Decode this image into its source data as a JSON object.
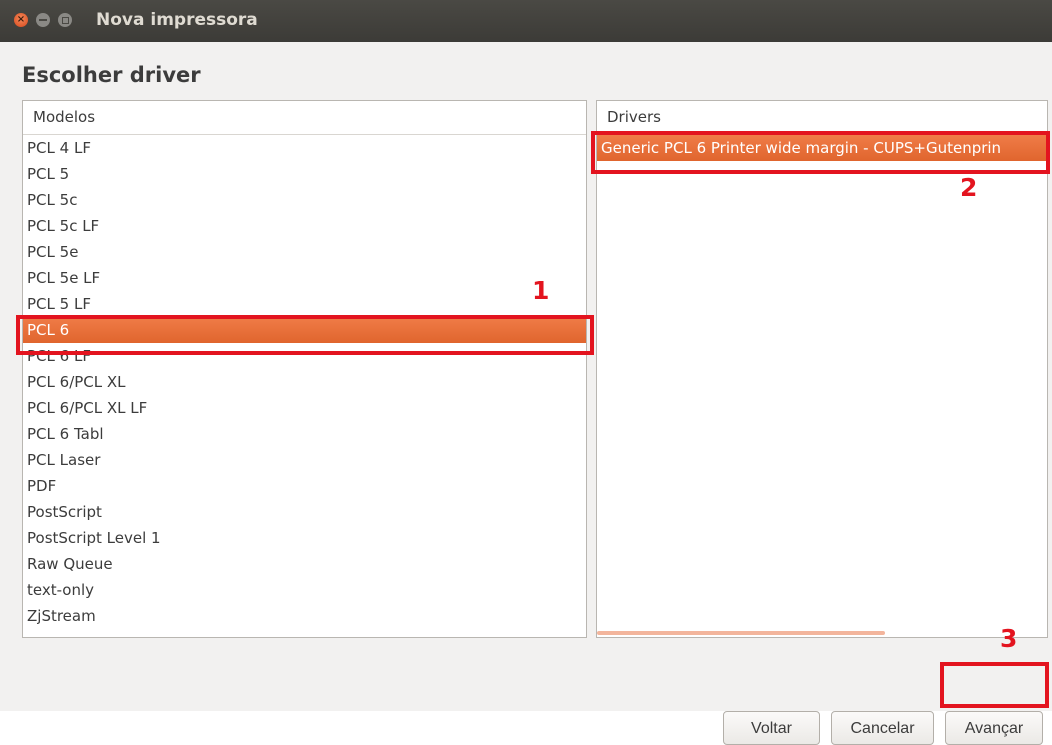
{
  "window": {
    "title": "Nova impressora",
    "close_glyph": "×"
  },
  "heading": "Escolher driver",
  "models": {
    "header": "Modelos",
    "items": [
      "PCL 4 LF",
      "PCL 5",
      "PCL 5c",
      "PCL 5c LF",
      "PCL 5e",
      "PCL 5e LF",
      "PCL 5 LF",
      "PCL 6",
      "PCL 6 LF",
      "PCL 6/PCL XL",
      "PCL 6/PCL XL LF",
      "PCL 6 Tabl",
      "PCL Laser",
      "PDF",
      "PostScript",
      "PostScript Level 1",
      "Raw Queue",
      "text-only",
      "ZjStream"
    ],
    "selected": "PCL 6"
  },
  "drivers": {
    "header": "Drivers",
    "items": [
      "Generic PCL 6 Printer wide margin - CUPS+Gutenprin"
    ],
    "selected": "Generic PCL 6 Printer wide margin - CUPS+Gutenprin"
  },
  "annotations": {
    "n1": "1",
    "n2": "2",
    "n3": "3",
    "color": "#e3141f"
  },
  "buttons": {
    "back": "Voltar",
    "cancel": "Cancelar",
    "next": "Avançar"
  },
  "colors": {
    "selection": "#e9713c",
    "titlebar": "#3c3b37",
    "annotation": "#e3141f"
  }
}
